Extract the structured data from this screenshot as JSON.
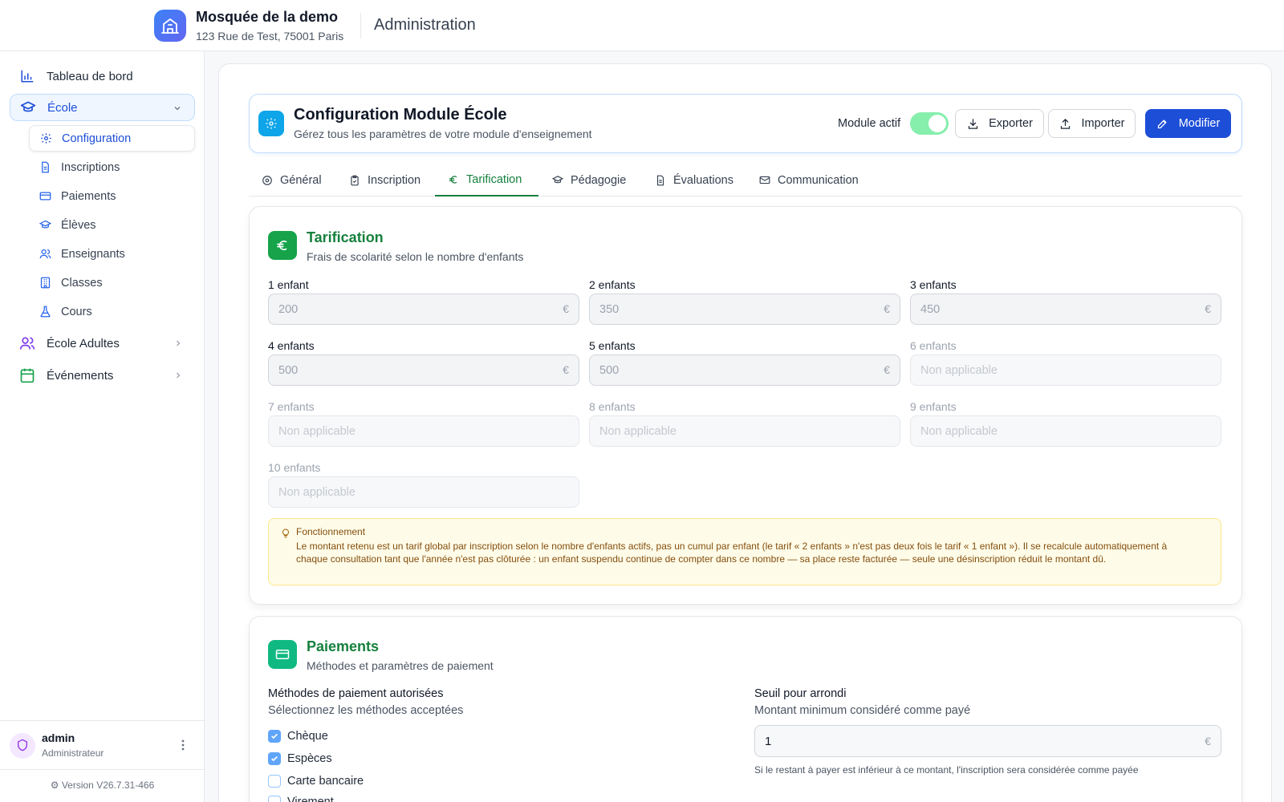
{
  "header": {
    "org_name": "Mosquée de la demo",
    "org_address": "123 Rue de Test, 75001 Paris",
    "title": "Administration"
  },
  "sidebar": {
    "items": [
      {
        "label": "Tableau de bord",
        "icon": "bar-chart-icon"
      },
      {
        "label": "École",
        "icon": "graduation-cap-icon"
      },
      {
        "label": "École Adultes",
        "icon": "users-icon"
      },
      {
        "label": "Événements",
        "icon": "calendar-icon"
      }
    ],
    "sub_items": [
      {
        "label": "Configuration",
        "icon": "gear-icon"
      },
      {
        "label": "Inscriptions",
        "icon": "document-icon"
      },
      {
        "label": "Paiements",
        "icon": "credit-card-icon"
      },
      {
        "label": "Élèves",
        "icon": "graduation-cap-icon"
      },
      {
        "label": "Enseignants",
        "icon": "users-icon"
      },
      {
        "label": "Classes",
        "icon": "building-icon"
      },
      {
        "label": "Cours",
        "icon": "flask-icon"
      }
    ],
    "user": {
      "name": "admin",
      "role": "Administrateur"
    },
    "version": "Version V26.7.31-466"
  },
  "config": {
    "title": "Configuration Module École",
    "subtitle": "Gérez tous les paramètres de votre module d'enseignement",
    "module_label": "Module actif",
    "module_active": true,
    "export_label": "Exporter",
    "import_label": "Importer",
    "edit_label": "Modifier"
  },
  "tabs": [
    {
      "label": "Général",
      "icon": "gear-icon"
    },
    {
      "label": "Inscription",
      "icon": "clipboard-icon"
    },
    {
      "label": "Tarification",
      "icon": "euro-icon",
      "active": true
    },
    {
      "label": "Pédagogie",
      "icon": "graduation-cap-icon"
    },
    {
      "label": "Évaluations",
      "icon": "document-icon"
    },
    {
      "label": "Communication",
      "icon": "mail-icon"
    }
  ],
  "tarification": {
    "title": "Tarification",
    "subtitle": "Frais de scolarité selon le nombre d'enfants",
    "currency": "€",
    "fields": [
      {
        "label": "1 enfant",
        "value": "200"
      },
      {
        "label": "2 enfants",
        "value": "350"
      },
      {
        "label": "3 enfants",
        "value": "450"
      },
      {
        "label": "4 enfants",
        "value": "500"
      },
      {
        "label": "5 enfants",
        "value": "500"
      },
      {
        "label": "6 enfants",
        "placeholder": "Non applicable"
      },
      {
        "label": "7 enfants",
        "placeholder": "Non applicable"
      },
      {
        "label": "8 enfants",
        "placeholder": "Non applicable"
      },
      {
        "label": "9 enfants",
        "placeholder": "Non applicable"
      },
      {
        "label": "10 enfants",
        "placeholder": "Non applicable"
      }
    ],
    "note_title": "Fonctionnement",
    "note_text": "Le montant retenu est un tarif global par inscription selon le nombre d'enfants actifs, pas un cumul par enfant (le tarif « 2 enfants » n'est pas deux fois le tarif « 1 enfant »). Il se recalcule automatiquement à chaque consultation tant que l'année n'est pas clôturée : un enfant suspendu continue de compter dans ce nombre — sa place reste facturée — seule une désinscription réduit le montant dû."
  },
  "paiements": {
    "title": "Paiements",
    "subtitle": "Méthodes et paramètres de paiement",
    "methods_label": "Méthodes de paiement autorisées",
    "methods_sub": "Sélectionnez les méthodes acceptées",
    "methods": [
      {
        "label": "Chèque",
        "checked": true
      },
      {
        "label": "Espèces",
        "checked": true
      },
      {
        "label": "Carte bancaire",
        "checked": false
      },
      {
        "label": "Virement",
        "checked": false
      }
    ],
    "threshold_label": "Seuil pour arrondi",
    "threshold_sub": "Montant minimum considéré comme payé",
    "threshold_value": "1",
    "threshold_unit": "€",
    "threshold_help": "Si le restant à payer est inférieur à ce montant, l'inscription sera considérée comme payée"
  },
  "colors": {
    "primary": "#1d4ed8",
    "accent_green": "#15803d",
    "toggle_on": "#86efac"
  }
}
